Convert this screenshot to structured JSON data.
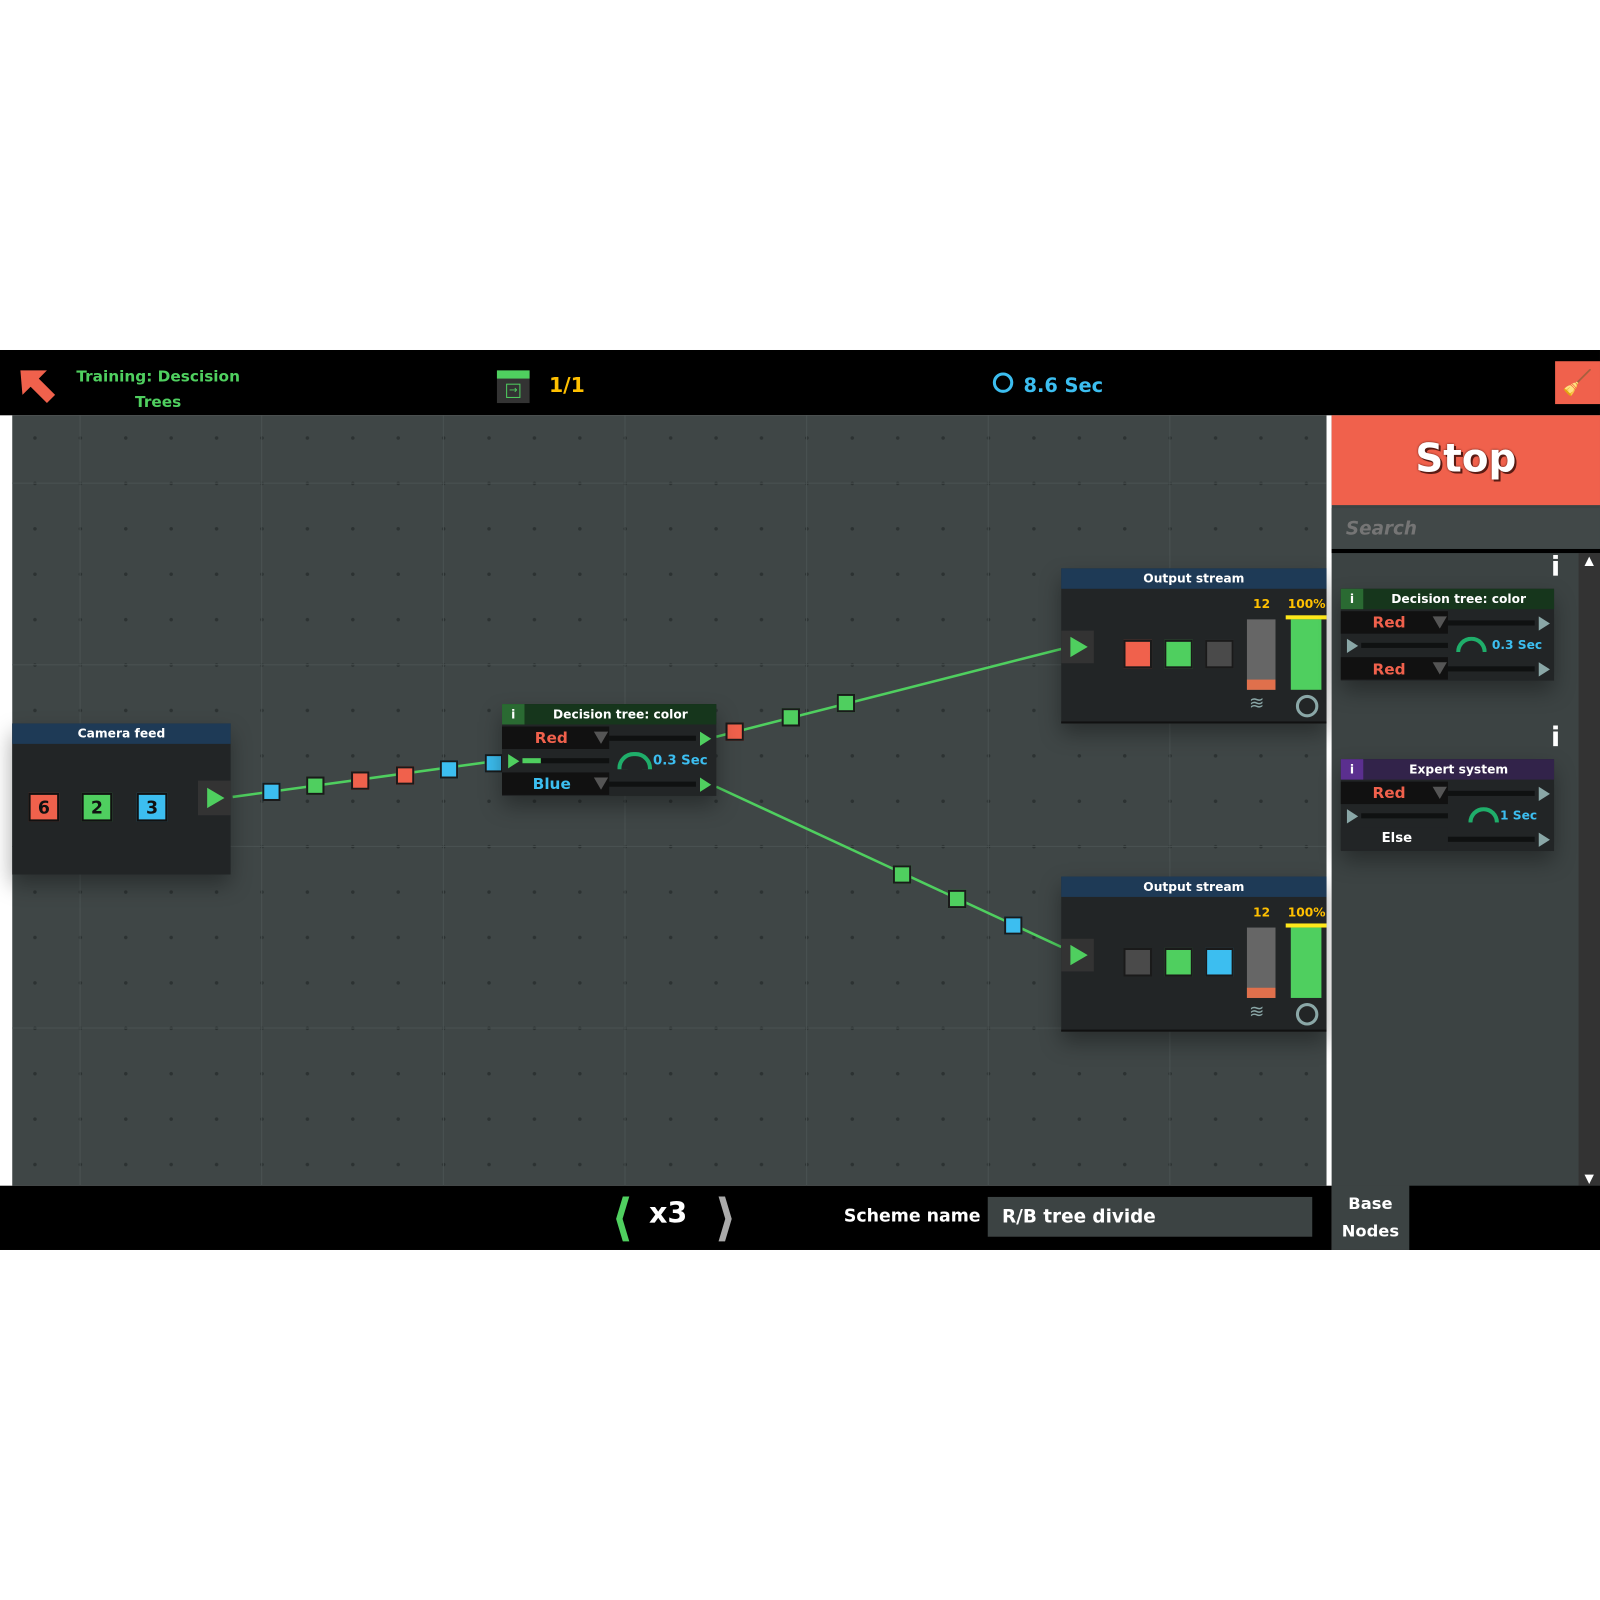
{
  "header": {
    "title_line1": "Training: Descision",
    "title_line2": "Trees",
    "page_counter": "1/1",
    "timer": "8.6 Sec"
  },
  "colors": {
    "red": "#f0614c",
    "green": "#4fcf5f",
    "blue": "#3cbef0",
    "gray": "#4a4a4a",
    "yellow": "#ffc000",
    "accent": "#f0614c"
  },
  "camera_feed": {
    "title": "Camera feed",
    "counts": [
      {
        "value": "6",
        "color": "red"
      },
      {
        "value": "2",
        "color": "green"
      },
      {
        "value": "3",
        "color": "blue"
      }
    ]
  },
  "decision_node": {
    "info": "i",
    "title": "Decision tree: color",
    "option1": "Red",
    "option2": "Blue",
    "speed": "0.3 Sec"
  },
  "outputs": [
    {
      "title": "Output stream",
      "count": "12",
      "percent": "100%",
      "progress": 1.0,
      "buffer_fill": 0.15,
      "slots": [
        "red",
        "green",
        "gray"
      ]
    },
    {
      "title": "Output stream",
      "count": "12",
      "percent": "100%",
      "progress": 1.0,
      "buffer_fill": 0.15,
      "slots": [
        "gray",
        "green",
        "blue"
      ]
    }
  ],
  "packets": {
    "input": [
      "blue",
      "green",
      "red",
      "red",
      "blue",
      "blue"
    ],
    "upper": [
      "red",
      "green",
      "green"
    ],
    "lower": [
      "green",
      "green",
      "blue"
    ]
  },
  "sidebar": {
    "stop_label": "Stop",
    "search_placeholder": "Search",
    "items": [
      {
        "info": "i",
        "title": "Decision tree: color",
        "option1": "Red",
        "option2": "Red",
        "speed": "0.3 Sec"
      },
      {
        "info": "i",
        "title": "Expert system",
        "option1": "Red",
        "option2": "Else",
        "speed": "1 Sec"
      }
    ],
    "category_line1": "Base",
    "category_line2": "Nodes"
  },
  "footer": {
    "speed": "x3",
    "scheme_label": "Scheme name :",
    "scheme_name": "R/B tree divide"
  }
}
